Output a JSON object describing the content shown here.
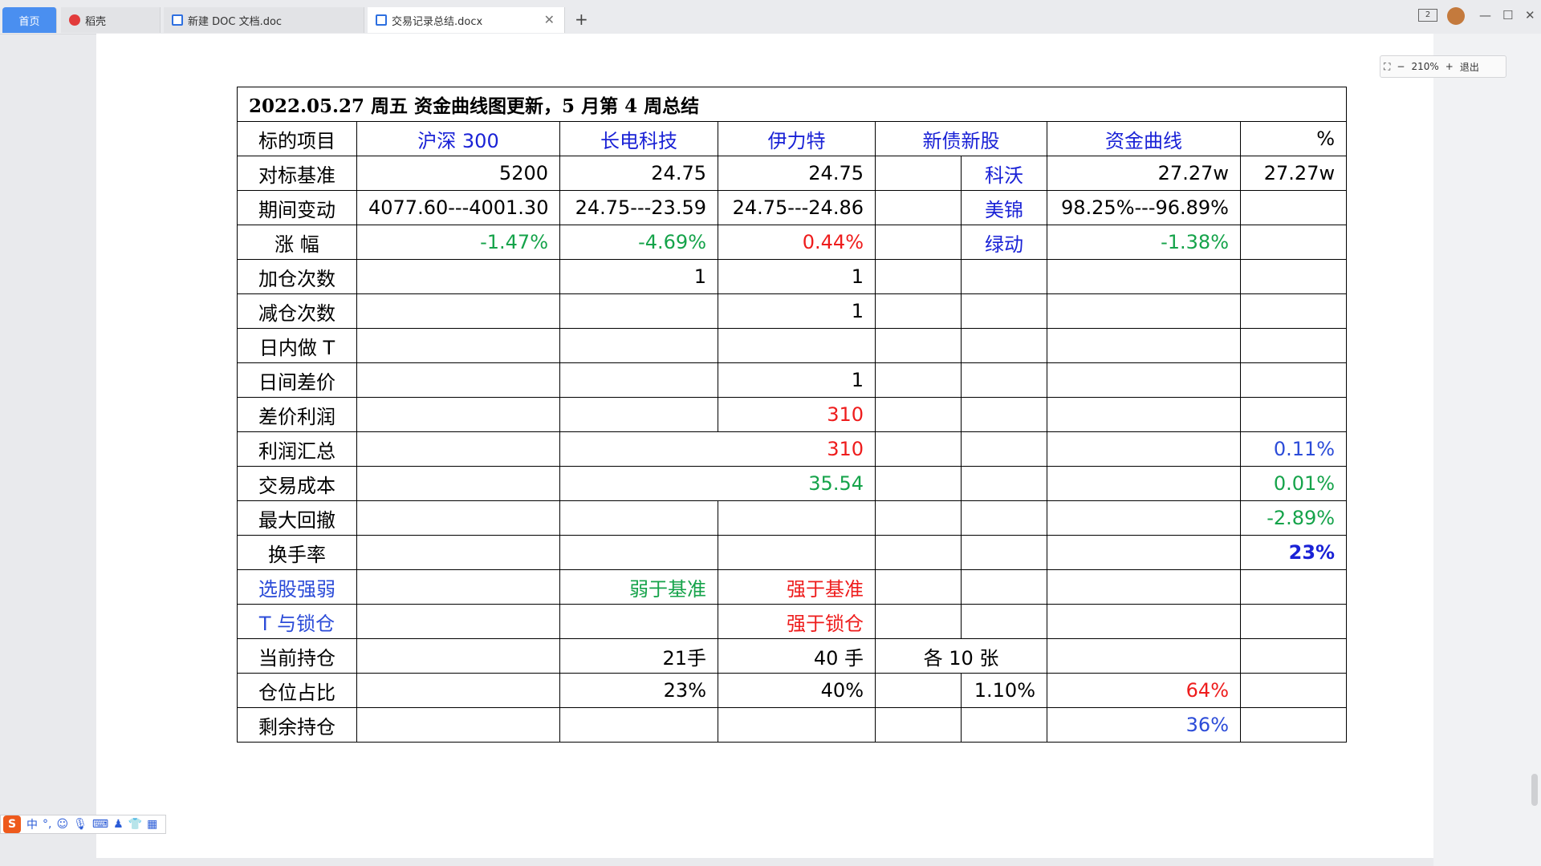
{
  "tabs": {
    "home": "首页",
    "t1": "稻壳",
    "t2": "新建 DOC 文档.doc",
    "t3": "交易记录总结.docx"
  },
  "zoom": {
    "value": "210%",
    "minus": "−",
    "plus": "+",
    "exit": "退出"
  },
  "ime": {
    "lang": "中",
    "punct": "°,"
  },
  "table": {
    "title": "2022.05.27 周五 资金曲线图更新，5 月第 4 周总结",
    "header": [
      "标的项目",
      "沪深 300",
      "长电科技",
      "伊力特",
      "新债新股",
      "资金曲线",
      "%"
    ],
    "rows": {
      "benchmark": {
        "label": "对标基准",
        "hs300": "5200",
        "cd": "24.75",
        "ylt": "24.75",
        "name": "科沃",
        "curve": "27.27w",
        "pct": "27.27w"
      },
      "change": {
        "label": "期间变动",
        "hs300": "4077.60---4001.30",
        "cd": "24.75---23.59",
        "ylt": "24.75---24.86",
        "name": "美锦",
        "curve": "98.25%---96.89%"
      },
      "rise": {
        "label": "涨 幅",
        "hs300": "-1.47%",
        "cd": "-4.69%",
        "ylt": "0.44%",
        "name": "绿动",
        "curve": "-1.38%"
      },
      "add": {
        "label": "加仓次数",
        "cd": "1",
        "ylt": "1"
      },
      "reduce": {
        "label": "减仓次数",
        "ylt": "1"
      },
      "intraday": {
        "label": "日内做 T"
      },
      "interday": {
        "label": "日间差价",
        "ylt": "1"
      },
      "spread": {
        "label": "差价利润",
        "ylt": "310"
      },
      "profit": {
        "label": "利润汇总",
        "merged": "310",
        "pct": "0.11%"
      },
      "cost": {
        "label": "交易成本",
        "merged": "35.54",
        "pct": "0.01%"
      },
      "drawdown": {
        "label": "最大回撤",
        "pct": "-2.89%"
      },
      "turnover": {
        "label": "换手率",
        "pct": "23%"
      },
      "pick": {
        "label": "选股强弱",
        "cd": "弱于基准",
        "ylt": "强于基准"
      },
      "tlock": {
        "label": "T 与锁仓",
        "ylt": "强于锁仓"
      },
      "holding": {
        "label": "当前持仓",
        "cd": "21手",
        "ylt": "40 手",
        "bond": "各 10 张"
      },
      "ratio": {
        "label": "仓位占比",
        "cd": "23%",
        "ylt": "40%",
        "bond": "1.10%",
        "curve": "64%"
      },
      "remain": {
        "label": "剩余持仓",
        "curve": "36%"
      }
    }
  },
  "colors": {
    "blue": "#1a22d6",
    "green": "#15a34a",
    "red": "#ee1c1c",
    "tab_active": "#4a8ff0"
  }
}
